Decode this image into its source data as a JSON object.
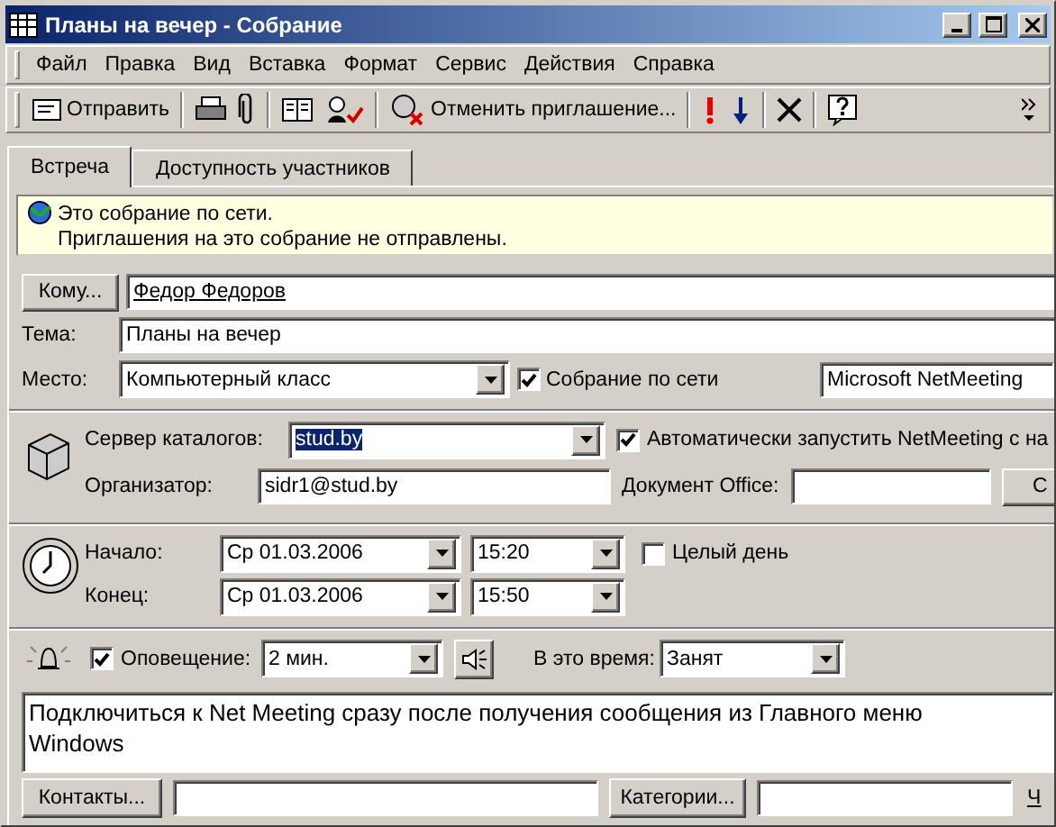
{
  "window": {
    "title": "Планы на вечер - Собрание"
  },
  "menu": [
    "Файл",
    "Правка",
    "Вид",
    "Вставка",
    "Формат",
    "Сервис",
    "Действия",
    "Справка"
  ],
  "toolbar": {
    "send": "Отправить",
    "cancel_invitation": "Отменить приглашение..."
  },
  "tabs": [
    {
      "label": "Встреча",
      "selected": true
    },
    {
      "label": "Доступность участников",
      "selected": false
    }
  ],
  "info": [
    "Это собрание по сети.",
    "Приглашения на это собрание не отправлены."
  ],
  "to": {
    "button": "Кому...",
    "value": "Федор Федоров"
  },
  "subject": {
    "label": "Тема:",
    "value": "Планы на вечер"
  },
  "location": {
    "label": "Место:",
    "value": "Компьютерный класс"
  },
  "online_meeting": {
    "label": "Собрание по сети",
    "checked": true
  },
  "program": "Microsoft NetMeeting",
  "server": {
    "label": "Сервер каталогов:",
    "value": "stud.by",
    "text_selected": true
  },
  "autostart": {
    "label": "Автоматически запустить NetMeeting с на",
    "checked": true
  },
  "organizer": {
    "label": "Организатор:",
    "value": "sidr1@stud.by"
  },
  "office_doc": {
    "label": "Документ Office:",
    "button": "С"
  },
  "start": {
    "label": "Начало:",
    "date": "Ср 01.03.2006",
    "time": "15:20"
  },
  "all_day": {
    "label": "Целый день",
    "checked": false
  },
  "end": {
    "label": "Конец:",
    "date": "Ср 01.03.2006",
    "time": "15:50"
  },
  "reminder": {
    "label": "Оповещение:",
    "checked": true,
    "value": "2 мин."
  },
  "show_as": {
    "label": "В это время:",
    "value": "Занят"
  },
  "notes": "Подключиться к Net Meeting сразу после получения сообщения из Главного меню Windows",
  "contacts": {
    "button": "Контакты..."
  },
  "categories": {
    "button": "Категории..."
  },
  "private_label": "Ч"
}
